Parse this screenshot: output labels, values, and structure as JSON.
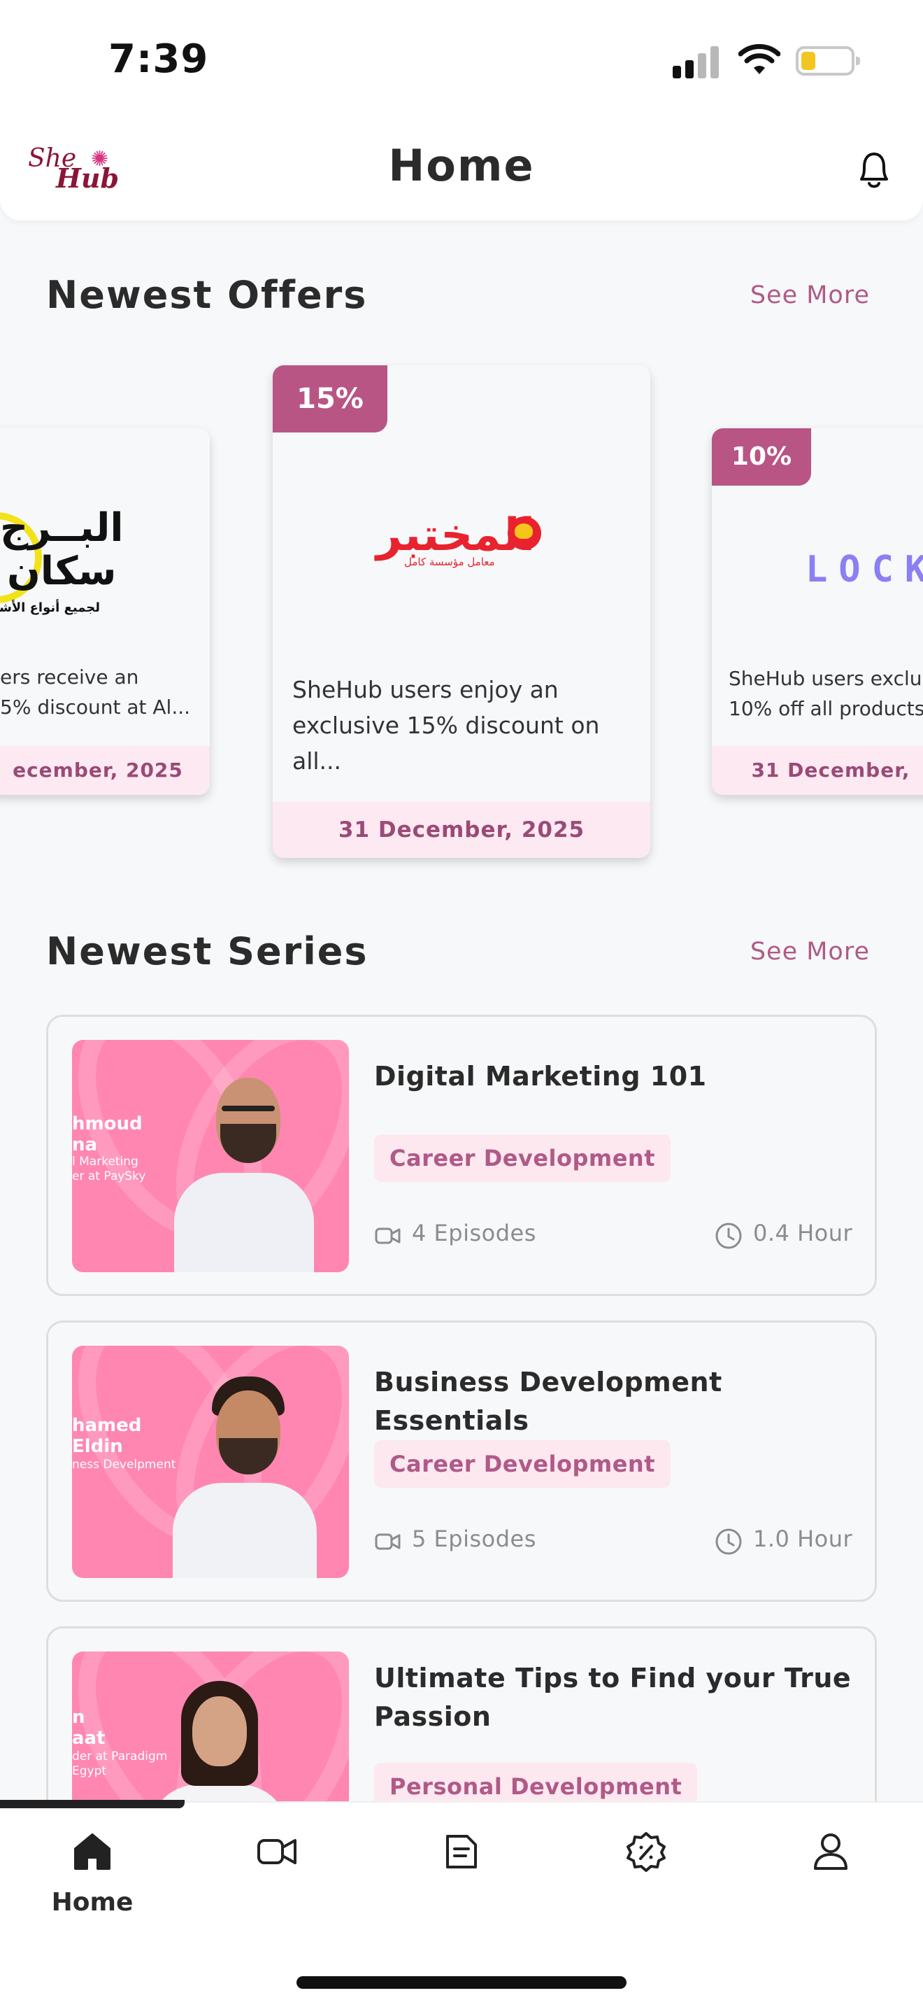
{
  "status_bar": {
    "time": "7:39"
  },
  "header": {
    "title": "Home",
    "logo_text_1": "She",
    "logo_text_2": "Hub"
  },
  "offers": {
    "title": "Newest Offers",
    "see_more": "See More",
    "items": [
      {
        "discount": "",
        "logo_line_1": "البــرج",
        "logo_line_2": "سكان",
        "logo_line_3": "لجميع أنواع الأشعة",
        "description_line_1": "ers receive an",
        "description_line_2": "5% discount at Al...",
        "date": "ecember, 2025"
      },
      {
        "discount": "15%",
        "logo_line_1": "المختبر",
        "logo_line_3": "معامل مؤسسة كامل",
        "description_line_1": "SheHub users enjoy an",
        "description_line_2": "exclusive 15% discount on all...",
        "date": "31 December, 2025"
      },
      {
        "discount": "10%",
        "logo_line_1": "LOCKe",
        "description_line_1": "SheHub users exclus",
        "description_line_2": "10% off all products",
        "date": "31 December,"
      }
    ]
  },
  "series": {
    "title": "Newest Series",
    "see_more": "See More",
    "items": [
      {
        "title": "Digital Marketing 101",
        "tag": "Career Development",
        "episodes": "4 Episodes",
        "duration": "0.4  Hour",
        "thumb_name": "hmoud\nna",
        "thumb_role": "l Marketing\ner at PaySky"
      },
      {
        "title": "Business Development Essentials",
        "tag": "Career Development",
        "episodes": "5 Episodes",
        "duration": "1.0  Hour",
        "thumb_name": "hamed\nEldin",
        "thumb_role": "ness Develpment"
      },
      {
        "title": "Ultimate Tips to Find your True Passion",
        "tag": "Personal Development",
        "thumb_name": "n\naat",
        "thumb_role": "der at Paradigm\nEgypt"
      }
    ]
  },
  "tabbar": {
    "items": [
      {
        "label": "Home",
        "icon": "home-icon",
        "active": true
      },
      {
        "label": "",
        "icon": "video-icon"
      },
      {
        "label": "",
        "icon": "document-icon"
      },
      {
        "label": "",
        "icon": "discount-icon"
      },
      {
        "label": "",
        "icon": "profile-icon"
      }
    ]
  },
  "colors": {
    "accent": "#b85585",
    "tag_bg": "#fde8f0",
    "thumb_pink": "#ff86b1",
    "background": "#f7f8fa"
  }
}
